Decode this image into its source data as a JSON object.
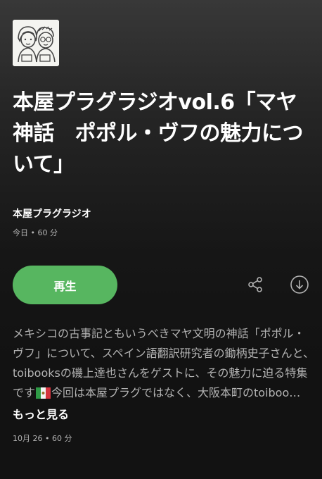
{
  "episode": {
    "title": "本屋プラグラジオvol.6「マヤ神話　ポポル・ヴフの魅力について」",
    "show_name": "本屋プラグラジオ",
    "meta_day": "今日",
    "meta_separator": "•",
    "meta_duration": "60 分"
  },
  "actions": {
    "play_label": "再生",
    "share_icon": "share-icon",
    "download_icon": "download-icon"
  },
  "description": {
    "text_before_flag": "メキシコの古事記ともいうべきマヤ文明の神話「ポポル・ヴフ」について、スペイン語翻訳研究者の鋤柄史子さんと、toibooksの磯上達也さんをゲストに、その魅力に迫る特集です",
    "flag_icon": "mexico-flag",
    "text_after_flag": "今回は本屋プラグではなく、大阪本町のtoiboo…",
    "more_label": "もっと見る"
  },
  "footer": {
    "date": "10月 26",
    "separator": "•",
    "duration": "60 分"
  },
  "colors": {
    "accent": "#57b660",
    "background": "#121212",
    "secondary_text": "#b3b3b3"
  }
}
